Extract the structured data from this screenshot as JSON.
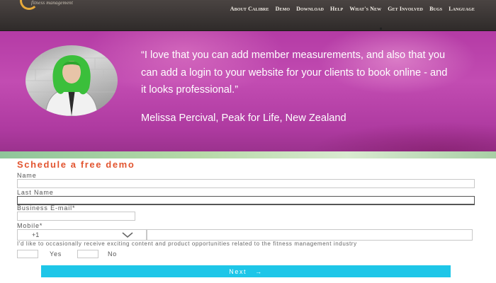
{
  "brand": {
    "tagline": "fitness management"
  },
  "nav": {
    "items": [
      {
        "label": "About Calibre"
      },
      {
        "label": "Demo"
      },
      {
        "label": "Download"
      },
      {
        "label": "Help"
      },
      {
        "label": "What's New"
      },
      {
        "label": "Get Involved"
      },
      {
        "label": "Bugs"
      },
      {
        "label": "Language"
      }
    ]
  },
  "testimonial": {
    "quote": "“I love that you can add member measurements, and also that you can add a login to your website for your clients to book online - and it looks professional.”",
    "author": "Melissa Percival, Peak for Life, New Zealand"
  },
  "form": {
    "title": "Schedule a free demo",
    "name_label": "Name",
    "last_name_label": "Last Name",
    "email_label": "Business E-mail*",
    "mobile_label": "Mobile*",
    "country_code": "+1",
    "consent_text": "I'd like to occasionally receive exciting content and product opportunities related to the fitness management industry",
    "yes_label": "Yes",
    "no_label": "No",
    "next_label": "Next",
    "next_arrow": "→",
    "colors": {
      "title": "#e2542f",
      "button": "#1ec6e8"
    }
  },
  "colors": {
    "topbar": "#3a3533",
    "banner": "#b43ba5"
  }
}
